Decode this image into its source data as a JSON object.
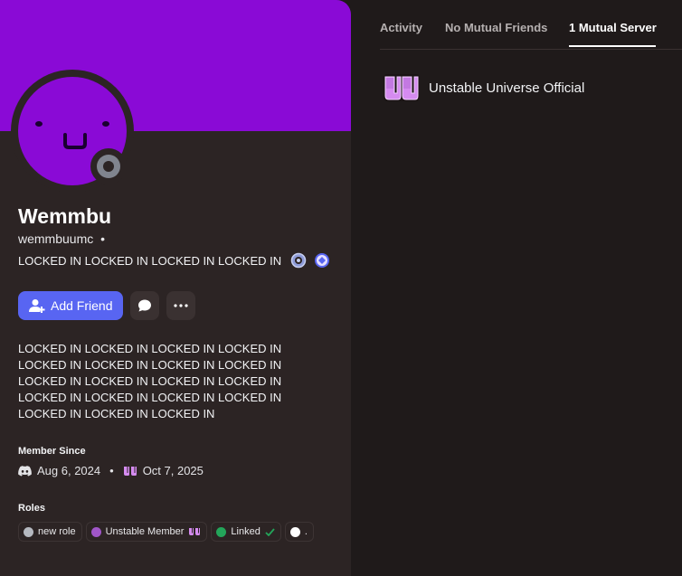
{
  "profile": {
    "display_name": "Wemmbu",
    "username": "wemmbuumc",
    "username_separator": "•",
    "custom_status": "LOCKED IN LOCKED IN LOCKED IN LOCKED IN",
    "status": "offline",
    "banner_color": "#8a0ad6",
    "avatar_color": "#8a0ad6",
    "badges": [
      "quest-badge-icon",
      "nitro-badge-icon"
    ]
  },
  "actions": {
    "add_friend_label": "Add Friend",
    "message_icon": "chat-bubble-icon",
    "more_icon": "ellipsis-icon"
  },
  "bio": "LOCKED IN LOCKED IN LOCKED IN LOCKED IN LOCKED IN LOCKED IN LOCKED IN LOCKED IN LOCKED IN LOCKED IN LOCKED IN LOCKED IN LOCKED IN LOCKED IN LOCKED IN LOCKED IN LOCKED IN LOCKED IN LOCKED IN",
  "member_since": {
    "title": "Member Since",
    "discord_date": "Aug 6, 2024",
    "separator": "•",
    "server_date": "Oct 7, 2025"
  },
  "roles": {
    "title": "Roles",
    "items": [
      {
        "label": "new role",
        "color": "#b5b9c0"
      },
      {
        "label": "Unstable Member",
        "color": "#a056c8",
        "icon": "uu-icon"
      },
      {
        "label": "Linked",
        "color": "#23a55a",
        "icon": "check-icon"
      },
      {
        "label": ".",
        "color": "#ffffff"
      }
    ]
  },
  "tabs": {
    "items": [
      {
        "label": "Activity"
      },
      {
        "label": "No Mutual Friends"
      },
      {
        "label": "1 Mutual Server"
      }
    ],
    "active": "1 Mutual Server"
  },
  "mutual_servers": [
    {
      "name": "Unstable Universe Official",
      "icon": "uu-server-icon"
    }
  ],
  "colors": {
    "accent": "#5865f2",
    "background": "#1f1a1a",
    "panel": "#2c2424"
  }
}
